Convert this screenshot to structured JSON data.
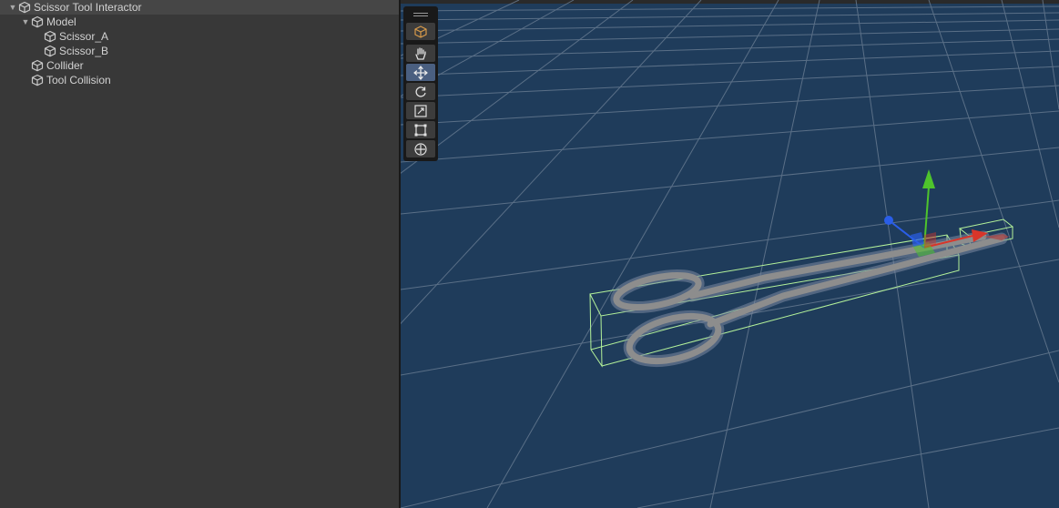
{
  "hierarchy": {
    "items": [
      {
        "label": "Scissor Tool Interactor",
        "depth": 0,
        "expanded": true,
        "selected": true
      },
      {
        "label": "Model",
        "depth": 1,
        "expanded": true,
        "selected": false
      },
      {
        "label": "Scissor_A",
        "depth": 2,
        "expanded": false,
        "selected": false
      },
      {
        "label": "Scissor_B",
        "depth": 2,
        "expanded": false,
        "selected": false
      },
      {
        "label": "Collider",
        "depth": 1,
        "expanded": false,
        "selected": false
      },
      {
        "label": "Tool Collision",
        "depth": 1,
        "expanded": false,
        "selected": false
      }
    ]
  },
  "scene_view": {
    "tools": [
      {
        "name": "view-tool",
        "icon": "cube-icon",
        "active": false
      },
      {
        "name": "hand-tool",
        "icon": "hand-icon",
        "active": false
      },
      {
        "name": "move-tool",
        "icon": "move-arrows-icon",
        "active": true
      },
      {
        "name": "rotate-tool",
        "icon": "rotate-icon",
        "active": false
      },
      {
        "name": "scale-tool",
        "icon": "scale-icon",
        "active": false
      },
      {
        "name": "rect-tool",
        "icon": "rect-icon",
        "active": false
      },
      {
        "name": "transform-tool",
        "icon": "transform-icon",
        "active": false
      }
    ],
    "colors": {
      "background": "#1f3c5b",
      "grid": "#6b7f94",
      "collider": "#a8f08a",
      "gizmo_x": "#d8352a",
      "gizmo_y": "#4ec42c",
      "gizmo_z": "#2a5ee8"
    }
  }
}
